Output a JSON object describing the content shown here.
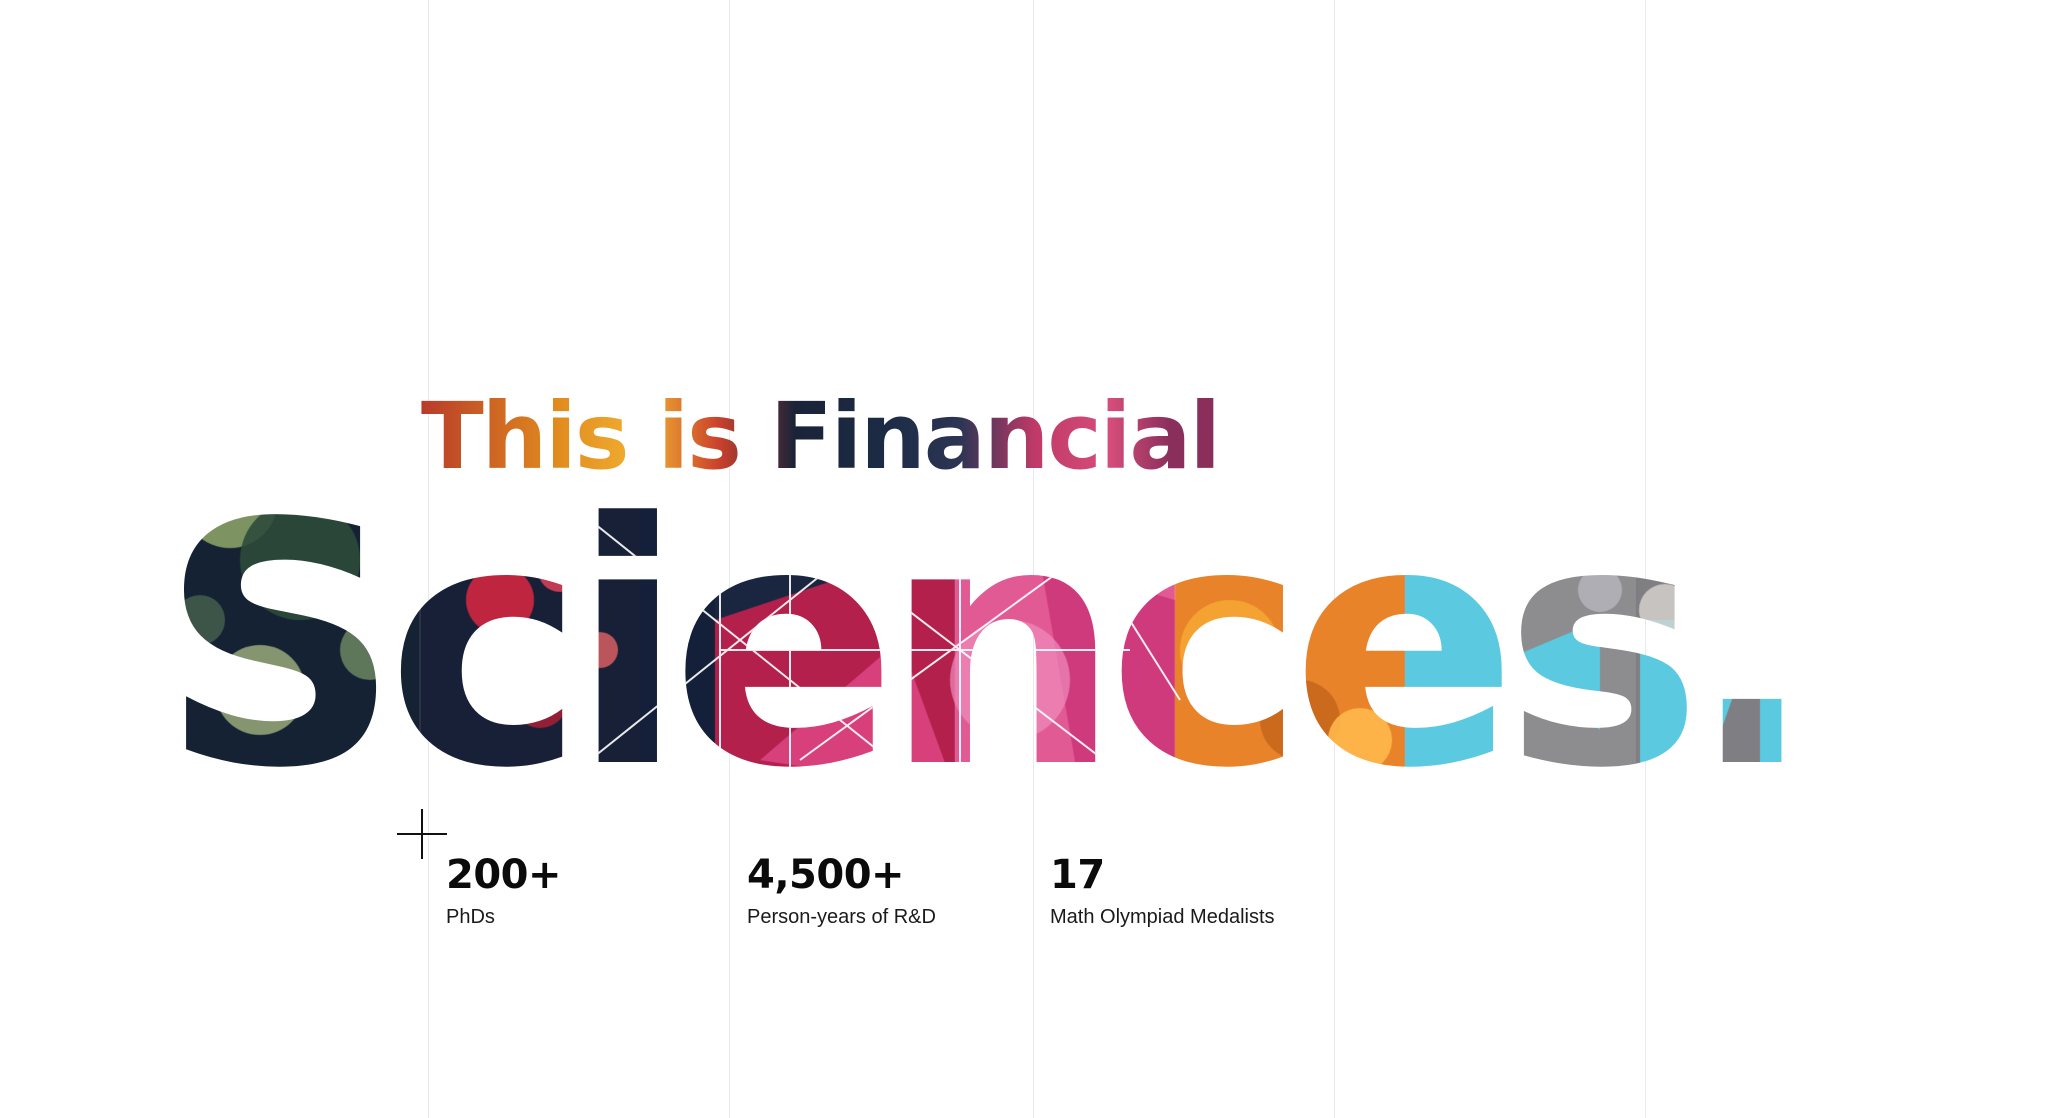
{
  "headline": {
    "line1": "This is Financial",
    "line2": "Sciences."
  },
  "stats": [
    {
      "value": "200+",
      "label": "PhDs"
    },
    {
      "value": "4,500+",
      "label": "Person-years of R&D"
    },
    {
      "value": "17",
      "label": "Math Olympiad Medalists"
    }
  ],
  "colors": {
    "background": "#ffffff",
    "gridline": "#e9e9ec",
    "navy": "#132033",
    "magenta": "#d8457c",
    "pink": "#ec6fa9",
    "orange": "#f08a24",
    "red": "#c9302c",
    "gray": "#8a8a8a",
    "cyan": "#5bc9df",
    "text": "#0b0b0b"
  }
}
